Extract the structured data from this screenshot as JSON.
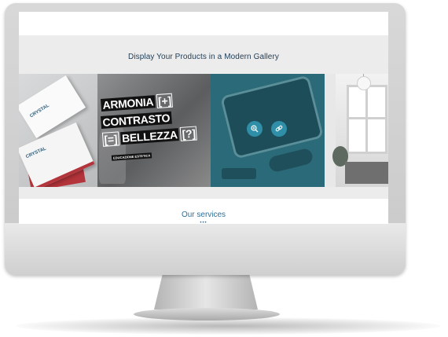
{
  "gallery": {
    "title": "Display Your Products in a Modern Gallery",
    "tiles": [
      {
        "logo": "CRYSTAL"
      },
      {
        "poster_lines": [
          "ARMONIA",
          "[+]",
          "CONTRASTO",
          "[=]",
          "BELLEZZA",
          "[?]"
        ],
        "caption": "EDUCAZIONE ESTETICA"
      },
      {
        "zoom_icon": "zoom-in-icon",
        "link_icon": "link-icon"
      },
      {}
    ]
  },
  "services": {
    "title": "Our services",
    "dots": "•••"
  },
  "colors": {
    "title_color": "#1f3c56",
    "accent": "#2d6f9c",
    "overlay_teal": "#2b6b79",
    "overlay_button": "#2f8fa8",
    "card_red": "#b3343a"
  }
}
